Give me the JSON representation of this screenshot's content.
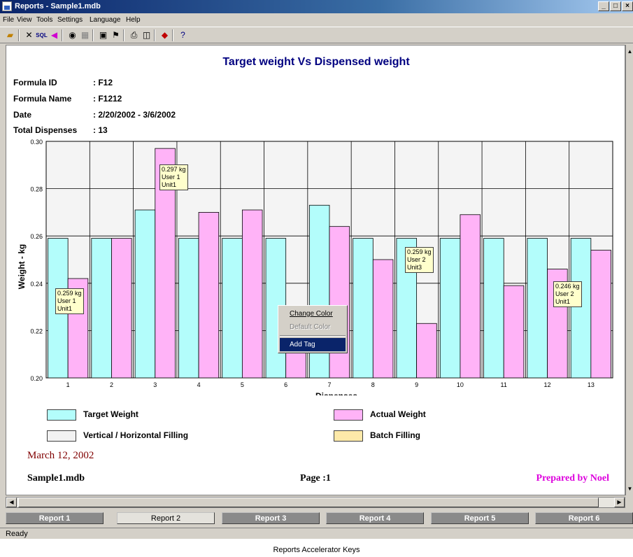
{
  "window": {
    "title": "Reports - Sample1.mdb",
    "min": "_",
    "max": "□",
    "close": "×"
  },
  "menu": [
    "File",
    "View",
    "Tools",
    "Settings",
    "Language",
    "Help"
  ],
  "toolbar": {
    "icons": [
      "open-folder-icon",
      "tools-icon",
      "sql-icon",
      "back-arrow-icon",
      "refresh-icon",
      "grid-icon",
      "edit-icon",
      "find-icon",
      "print-icon",
      "print-preview-icon",
      "export-icon",
      "help-icon"
    ],
    "sql_label": "SQL"
  },
  "report": {
    "title": "Target weight Vs Dispensed weight",
    "info": [
      {
        "label": "Formula ID",
        "value": ": F12"
      },
      {
        "label": "Formula Name",
        "value": ": F1212"
      },
      {
        "label": "Date",
        "value": ": 2/20/2002  -  3/6/2002"
      },
      {
        "label": "Total Dispenses",
        "value": ": 13"
      }
    ],
    "legend": [
      {
        "label": "Target Weight",
        "color": "#b3fdfb"
      },
      {
        "label": "Actual Weight",
        "color": "#ffb3f7"
      },
      {
        "label": "Vertical / Horizontal Filling",
        "color": "#f2f2f2"
      },
      {
        "label": "Batch Filling",
        "color": "#fde9a9"
      }
    ],
    "footer": {
      "date": "March 12, 2002",
      "file": "Sample1.mdb",
      "page": "Page :1",
      "prepared": "Prepared by Noel"
    }
  },
  "chart_data": {
    "type": "bar",
    "categories": [
      "1",
      "2",
      "3",
      "4",
      "5",
      "6",
      "7",
      "8",
      "9",
      "10",
      "11",
      "12",
      "13"
    ],
    "series": [
      {
        "name": "Target Weight",
        "color": "#b3fdfb",
        "values": [
          0.259,
          0.259,
          0.271,
          0.259,
          0.259,
          0.259,
          0.273,
          0.259,
          0.259,
          0.259,
          0.259,
          0.259,
          0.259
        ]
      },
      {
        "name": "Actual Weight",
        "color": "#ffb3f7",
        "values": [
          0.242,
          0.259,
          0.297,
          0.27,
          0.271,
          0.22,
          0.264,
          0.25,
          0.223,
          0.269,
          0.239,
          0.246,
          0.254
        ]
      }
    ],
    "xlabel": "Dispenses",
    "ylabel": "Weight - kg",
    "ylim": [
      0.2,
      0.3
    ],
    "yticks": [
      "0.20",
      "0.22",
      "0.24",
      "0.26",
      "0.28",
      "0.30"
    ],
    "grid": true,
    "annotations": [
      {
        "dispense": 1,
        "text": "0.259 kg\nUser 1\nUnit1"
      },
      {
        "dispense": 3,
        "text": "0.297 kg\nUser 1\nUnit1"
      },
      {
        "dispense": 9,
        "text": "0.259 kg\nUser 2\nUnit3"
      },
      {
        "dispense": 12,
        "text": "0.246 kg\nUser 2\nUnit1"
      }
    ]
  },
  "context_menu": {
    "items": [
      "Change Color",
      "Default Color",
      "Add Tag"
    ]
  },
  "report_tabs": [
    "Report 1",
    "Report 2",
    "Report 3",
    "Report 4",
    "Report 5",
    "Report 6"
  ],
  "status": "Ready",
  "caption": "Reports Accelerator Keys"
}
